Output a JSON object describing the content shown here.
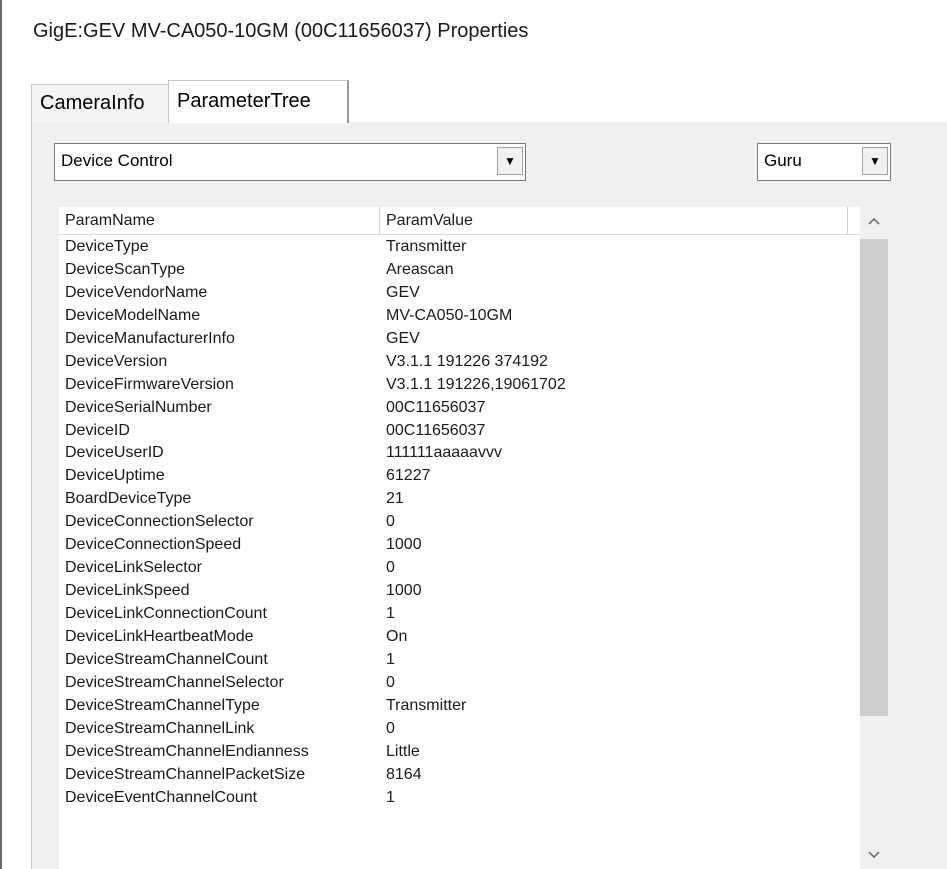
{
  "window": {
    "title": "GigE:GEV MV-CA050-10GM (00C11656037) Properties"
  },
  "tabs": [
    {
      "label": "CameraInfo",
      "active": false
    },
    {
      "label": "ParameterTree",
      "active": true
    }
  ],
  "category_select": {
    "value": "Device Control"
  },
  "level_select": {
    "value": "Guru"
  },
  "table": {
    "headers": [
      "ParamName",
      "ParamValue"
    ],
    "rows": [
      {
        "name": "DeviceType",
        "value": "Transmitter"
      },
      {
        "name": "DeviceScanType",
        "value": "Areascan"
      },
      {
        "name": "DeviceVendorName",
        "value": "GEV"
      },
      {
        "name": "DeviceModelName",
        "value": "MV-CA050-10GM"
      },
      {
        "name": "DeviceManufacturerInfo",
        "value": "GEV"
      },
      {
        "name": "DeviceVersion",
        "value": "V3.1.1 191226 374192"
      },
      {
        "name": "DeviceFirmwareVersion",
        "value": "V3.1.1 191226,19061702"
      },
      {
        "name": "DeviceSerialNumber",
        "value": "00C11656037"
      },
      {
        "name": "DeviceID",
        "value": "00C11656037"
      },
      {
        "name": "DeviceUserID",
        "value": "111111aaaaavvv"
      },
      {
        "name": "DeviceUptime",
        "value": "61227"
      },
      {
        "name": "BoardDeviceType",
        "value": "21"
      },
      {
        "name": "DeviceConnectionSelector",
        "value": "0"
      },
      {
        "name": "DeviceConnectionSpeed",
        "value": "1000"
      },
      {
        "name": "DeviceLinkSelector",
        "value": "0"
      },
      {
        "name": "DeviceLinkSpeed",
        "value": "1000"
      },
      {
        "name": "DeviceLinkConnectionCount",
        "value": "1"
      },
      {
        "name": "DeviceLinkHeartbeatMode",
        "value": "On"
      },
      {
        "name": "DeviceStreamChannelCount",
        "value": "1"
      },
      {
        "name": "DeviceStreamChannelSelector",
        "value": "0"
      },
      {
        "name": "DeviceStreamChannelType",
        "value": "Transmitter"
      },
      {
        "name": "DeviceStreamChannelLink",
        "value": "0"
      },
      {
        "name": "DeviceStreamChannelEndianness",
        "value": "Little"
      },
      {
        "name": "DeviceStreamChannelPacketSize",
        "value": "8164"
      },
      {
        "name": "DeviceEventChannelCount",
        "value": "1"
      }
    ]
  },
  "icons": {
    "dropdown": "chevron-down-icon",
    "scroll_up": "scroll-up-icon",
    "scroll_down": "scroll-down-icon"
  }
}
